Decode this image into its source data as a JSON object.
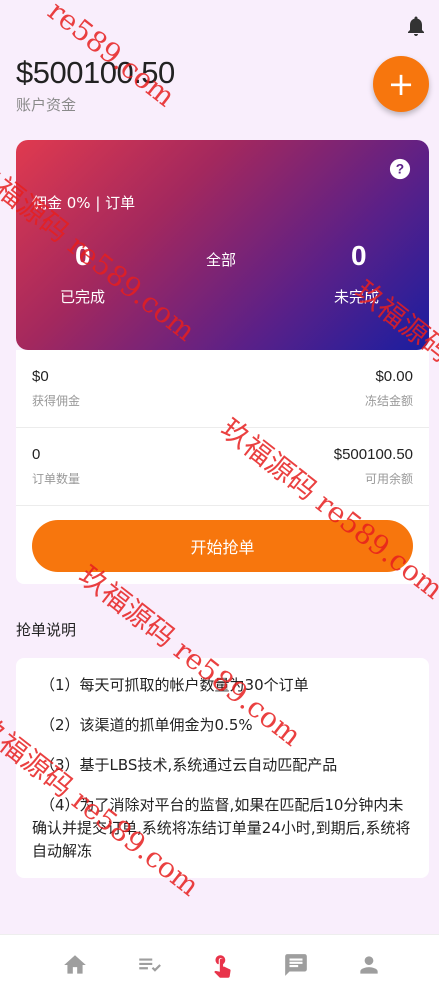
{
  "header": {
    "balance": "$500100.50",
    "balance_label": "账户资金",
    "fab_label": "+"
  },
  "card": {
    "commission_text": "佣金 0% |  订单",
    "completed_count": "0",
    "completed_label": "已完成",
    "all_label": "全部",
    "incomplete_count": "0",
    "incomplete_label": "未完成"
  },
  "stats": {
    "earned_value": "$0",
    "earned_label": "获得佣金",
    "frozen_value": "$0.00",
    "frozen_label": "冻结金额",
    "orders_value": "0",
    "orders_label": "订单数量",
    "available_value": "$500100.50",
    "available_label": "可用余额"
  },
  "grab_button_label": "开始抢单",
  "rules": {
    "title": "抢单说明",
    "items": [
      "（1）每天可抓取的帐户数量为30个订单",
      "（2）该渠道的抓单佣金为0.5%",
      "（3）基于LBS技术,系统通过云自动匹配产品",
      "（4）为了消除对平台的监督,如果在匹配后10分钟内未确认并提交订单,系统将冻结订单量24小时,到期后,系统将自动解冻"
    ]
  },
  "watermarks": [
    "re589.com",
    "玖福源码 re589.com",
    "玖福源码 re589.com",
    "玖福源码 re589.com",
    "玖福源码 re589.com",
    "玖福源码 re589.com",
    "玖福源码"
  ],
  "colors": {
    "accent": "#f7760d",
    "background": "#f9eefc",
    "active_tab": "#e8334a",
    "inactive_tab": "#9e9e9e"
  },
  "tabs": [
    "home-icon",
    "order-list-icon",
    "grab-order-icon",
    "message-icon",
    "profile-icon"
  ]
}
